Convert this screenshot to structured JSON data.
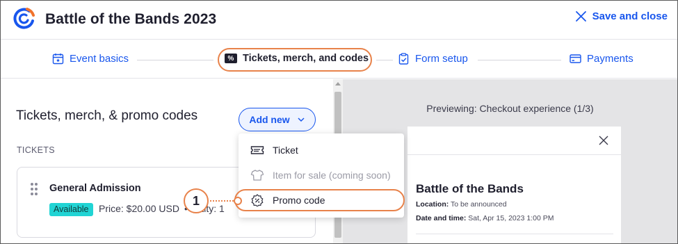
{
  "header": {
    "title": "Battle of the Bands 2023",
    "save_close_label": "Save and close"
  },
  "stepper": {
    "steps": [
      {
        "label": "Event basics",
        "icon": "calendar-icon"
      },
      {
        "label": "Tickets, merch, and codes",
        "icon": "ticket-percent-icon",
        "active": true
      },
      {
        "label": "Form setup",
        "icon": "clipboard-check-icon"
      },
      {
        "label": "Payments",
        "icon": "credit-card-icon"
      }
    ]
  },
  "left_panel": {
    "title": "Tickets, merch, & promo codes",
    "add_new_label": "Add new",
    "section_label": "TICKETS",
    "ticket": {
      "name": "General Admission",
      "status": "Available",
      "price": "Price: $20.00 USD",
      "qty_sep": "•",
      "qty_partial": "antity: 1"
    }
  },
  "dropdown": {
    "items": [
      {
        "label": "Ticket",
        "icon": "ticket-icon"
      },
      {
        "label": "Item for sale (coming soon)",
        "icon": "shirt-icon",
        "disabled": true
      },
      {
        "label": "Promo code",
        "icon": "promo-badge-icon"
      }
    ]
  },
  "callout": {
    "number": "1"
  },
  "preview": {
    "label": "Previewing: Checkout experience (1/3)",
    "title": "Battle of the Bands",
    "location_label": "Location:",
    "location_value": "To be announced",
    "datetime_label": "Date and time:",
    "datetime_value": "Sat, Apr 15, 2023 1:00 PM"
  },
  "colors": {
    "accent": "#1856ed",
    "highlight": "#e8824a",
    "badge": "#21d4d4"
  }
}
